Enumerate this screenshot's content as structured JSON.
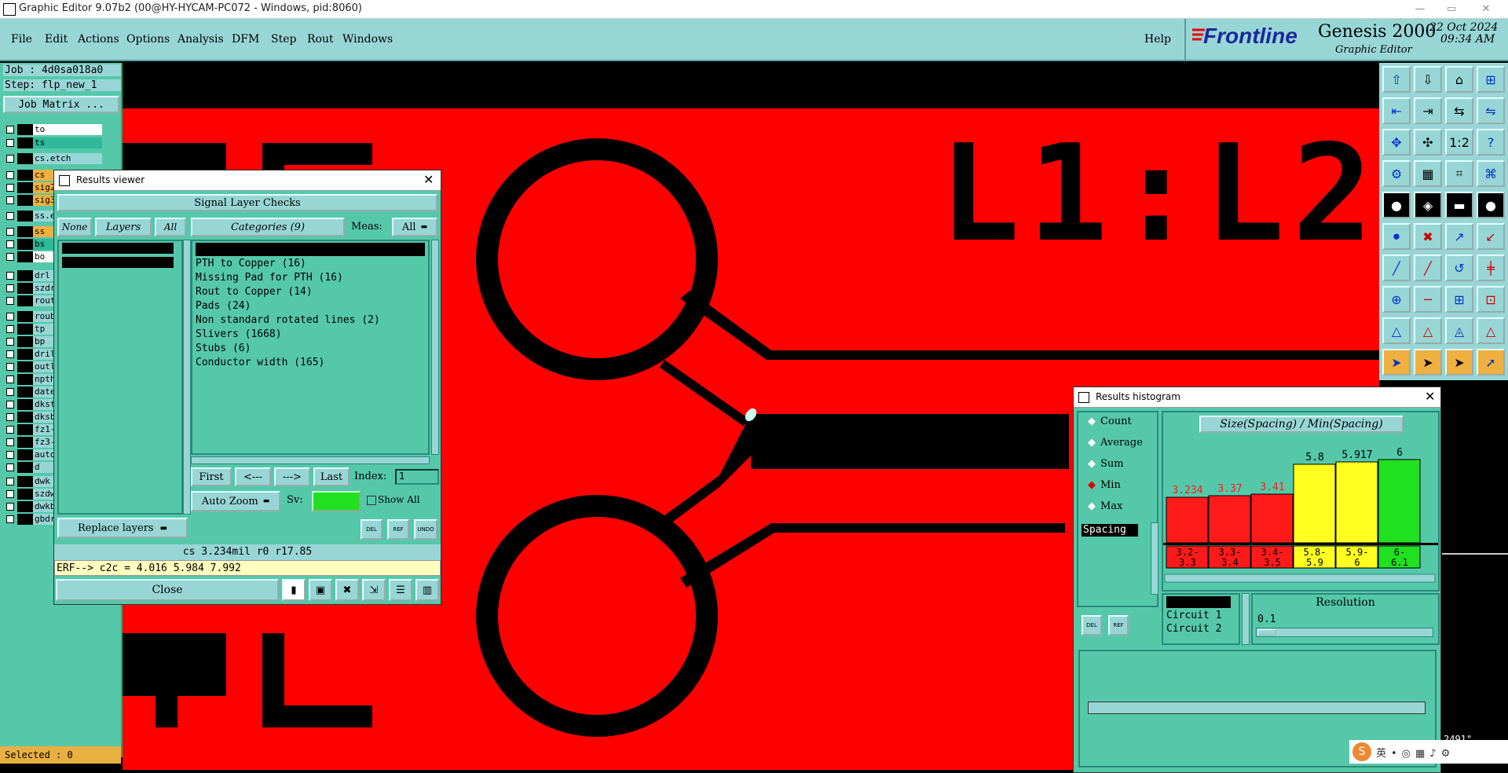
{
  "window": {
    "title": "Graphic Editor 9.07b2 (00@HY-HYCAM-PC072 - Windows, pid:8060)"
  },
  "menu": {
    "items": [
      "File",
      "Edit",
      "Actions",
      "Options",
      "Analysis",
      "DFM",
      "Step",
      "Rout",
      "Windows"
    ],
    "help": "Help"
  },
  "brand": {
    "logo": "Frontline",
    "product": "Genesis 2000",
    "subtitle": "Graphic Editor",
    "date": "22 Oct 2024",
    "time": "09:34 AM"
  },
  "job": {
    "job_label": "Job : 4d0sa018a0",
    "step_label": "Step: flp_new_1",
    "matrix_button": "Job Matrix ..."
  },
  "layers": [
    {
      "name": "to",
      "color": "#ffffff"
    },
    {
      "name": "ts",
      "color": "#2fb89a"
    },
    {
      "name": "cs.etch",
      "color": "#98d6d6"
    },
    {
      "name": "cs",
      "color": "#f0b040"
    },
    {
      "name": "sig2",
      "color": "#f0b040"
    },
    {
      "name": "sig3",
      "color": "#f0b040"
    },
    {
      "name": "ss.e",
      "color": "#98d6d6"
    },
    {
      "name": "ss",
      "color": "#f0b040"
    },
    {
      "name": "bs",
      "color": "#2fb89a"
    },
    {
      "name": "bo",
      "color": "#ffffff"
    },
    {
      "name": "drl",
      "color": "#98d6d6"
    },
    {
      "name": "szdr",
      "color": "#98d6d6"
    },
    {
      "name": "rout",
      "color": "#98d6d6"
    },
    {
      "name": "roub",
      "color": "#98d6d6"
    },
    {
      "name": "tp",
      "color": "#98d6d6"
    },
    {
      "name": "bp",
      "color": "#98d6d6"
    },
    {
      "name": "dril",
      "color": "#98d6d6"
    },
    {
      "name": "outl",
      "color": "#98d6d6"
    },
    {
      "name": "npth",
      "color": "#98d6d6"
    },
    {
      "name": "date",
      "color": "#98d6d6"
    },
    {
      "name": "dkst",
      "color": "#98d6d6"
    },
    {
      "name": "dksb",
      "color": "#98d6d6"
    },
    {
      "name": "fz1-",
      "color": "#98d6d6"
    },
    {
      "name": "fz3-",
      "color": "#98d6d6"
    },
    {
      "name": "auto",
      "color": "#98d6d6"
    },
    {
      "name": "d",
      "color": "#98d6d6"
    },
    {
      "name": "dwk",
      "color": "#98d6d6"
    },
    {
      "name": "szdw",
      "color": "#98d6d6"
    },
    {
      "name": "dwkb",
      "color": "#98d6d6"
    },
    {
      "name": "gbdr",
      "color": "#98d6d6"
    }
  ],
  "status": {
    "selected": "Selected : 0"
  },
  "canvas": {
    "label": "L1:L2",
    "partial_text": "2491\""
  },
  "results_viewer": {
    "title": "Results viewer",
    "heading": "Signal Layer Checks",
    "none_btn": "None",
    "layers_btn": "Layers",
    "all_btn": "All",
    "layer_list": [
      "cs",
      "ss"
    ],
    "categories_btn": "Categories (9)",
    "meas_label": "Meas:",
    "meas_value": "All",
    "categories": [
      "Circuit to circuit (82)",
      "PTH to Copper (16)",
      "Missing Pad for PTH (16)",
      "Rout to Copper (14)",
      "Pads (24)",
      "Non standard rotated lines (2)",
      "Slivers (1668)",
      "Stubs (6)",
      "Conductor width (165)"
    ],
    "nav": {
      "first": "First",
      "prev": "<---",
      "next": "--->",
      "last": "Last",
      "index_label": "Index:",
      "index_value": "1"
    },
    "zoom_label": "Auto Zoom",
    "sv_label": "Sv:",
    "show_all": "Show All",
    "replace_layers": "Replace layers",
    "small_btns": [
      "DEL",
      "REF",
      "UNDO"
    ],
    "measurement": "cs 3.234mil  r0  r17.85",
    "erf": "ERF--> c2c = 4.016 5.984 7.992",
    "close": "Close"
  },
  "histogram": {
    "title": "Results histogram",
    "modes": [
      "Count",
      "Average",
      "Sum",
      "Min",
      "Max"
    ],
    "selected_mode": "Min",
    "chart_title": "Size(Spacing) / Min(Spacing)",
    "field": "Spacing",
    "side_btns": [
      "DEL",
      "REF"
    ],
    "list": [
      "Spacing",
      "Circuit 1",
      "Circuit 2"
    ],
    "resolution_label": "Resolution",
    "resolution_value": "0.1",
    "colors": {
      "red": "#ff1a1a",
      "yellow": "#ffff20",
      "green": "#20e020"
    }
  },
  "chart_data": {
    "type": "bar",
    "title": "Size(Spacing) / Min(Spacing)",
    "categories": [
      "3.2-3.3",
      "3.3-3.4",
      "3.4-3.5",
      "5.8-5.9",
      "5.9-6",
      "6-6.1"
    ],
    "bin_labels": [
      [
        "3.2-",
        "3.3"
      ],
      [
        "3.3-",
        "3.4"
      ],
      [
        "3.4-",
        "3.5"
      ],
      [
        "5.8-",
        "5.9"
      ],
      [
        "5.9-",
        "6"
      ],
      [
        "6-",
        "6.1"
      ]
    ],
    "values": [
      3.234,
      3.37,
      3.41,
      5.8,
      5.917,
      6
    ],
    "value_labels": [
      "3.234",
      "3.37",
      "3.41",
      "5.8",
      "5.917",
      "6"
    ],
    "bar_colors": [
      "#ff1a1a",
      "#ff1a1a",
      "#ff1a1a",
      "#ffff20",
      "#ffff20",
      "#20e020"
    ],
    "ylim": [
      0,
      6.5
    ]
  }
}
